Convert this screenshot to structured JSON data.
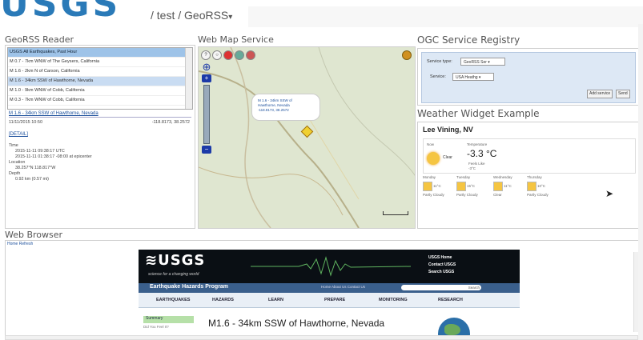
{
  "header": {
    "logo_fragment": "USGS",
    "breadcrumb": "/ test / GeoRSS",
    "caret": "▾"
  },
  "georss": {
    "title": "GeoRSS Reader",
    "feed_header": "USGS All Earthquakes, Past Hour",
    "items": [
      "M 0.7 - 7km WNW of The Geysers, California",
      "M 1.6 - 2km N of Carson, California",
      "M 1.6 - 34km SSW of Hawthorne, Nevada",
      "M 1.0 - 9km WNW of Cobb, California",
      "M 0.3 - 7km WNW of Cobb, California"
    ],
    "detail_title": "M 1.6 - 34km SSW of Hawthorne, Nevada",
    "detail_date": "11/11/2015 10:50",
    "detail_coords": "-118.8173, 38.2572",
    "detail_link": "[DETAIL]",
    "time_label": "Time",
    "time_utc": "2015-11-11 09:38:17 UTC",
    "time_local": "2015-11-11 01:38:17 -08:00 at epicenter",
    "location_label": "Location",
    "location_value": "38.257°N 118.817°W",
    "depth_label": "Depth",
    "depth_value": "0.92 km (0.57 mi)"
  },
  "map": {
    "title": "Web Map Service",
    "popup_lines": [
      "M 1.6 - 34km SSW of",
      "Hawthorne, Nevada",
      "-118.8173, 38.2572"
    ],
    "pan_icon": "⊕",
    "plus": "+",
    "minus": "−"
  },
  "ogc": {
    "title": "OGC Service Registry",
    "type_label": "Service type:",
    "type_value": "GeoRSS Ser ▾",
    "service_label": "Service:",
    "service_value": "USA Heathg ▾",
    "add_label": "Add service",
    "send_label": "Send"
  },
  "weather": {
    "title": "Weather Widget Example",
    "city": "Lee Vining, NV",
    "now_label": "Now",
    "temp_label": "Temperature",
    "condition": "Clear",
    "temp": "-3.3 °C",
    "feels_like": "Feels Like",
    "feels_value": "-3°C",
    "days": [
      {
        "name": "Monday",
        "temp": "11°C",
        "cond": "Partly Cloudy"
      },
      {
        "name": "Tuesday",
        "temp": "15°C",
        "cond": "Partly Cloudy"
      },
      {
        "name": "Wednesday",
        "temp": "11°C",
        "cond": "Clear"
      },
      {
        "name": "Thursday",
        "temp": "10°C",
        "cond": "Partly Cloudy"
      }
    ]
  },
  "browser": {
    "title": "Web Browser",
    "nav": "Home  Refresh",
    "logo": "≋USGS",
    "logo_sub": "science for a changing world",
    "links": [
      "USGS Home",
      "Contact USGS",
      "Search USGS"
    ],
    "program": "Earthquake Hazards Program",
    "program_links": "Home   About Us   Contact Us",
    "search": "Search",
    "menu": [
      "EARTHQUAKES",
      "HAZARDS",
      "LEARN",
      "PREPARE",
      "MONITORING",
      "RESEARCH"
    ],
    "summary_tab": "Summary",
    "summary_tab2": "Did You Feel It?",
    "event_title": "M1.6 - 34km SSW of Hawthorne, Nevada"
  },
  "colors": {
    "accent": "#2a7ab8",
    "feed_header": "#9ec3e8",
    "usgs_bar": "#3a5f8c"
  }
}
